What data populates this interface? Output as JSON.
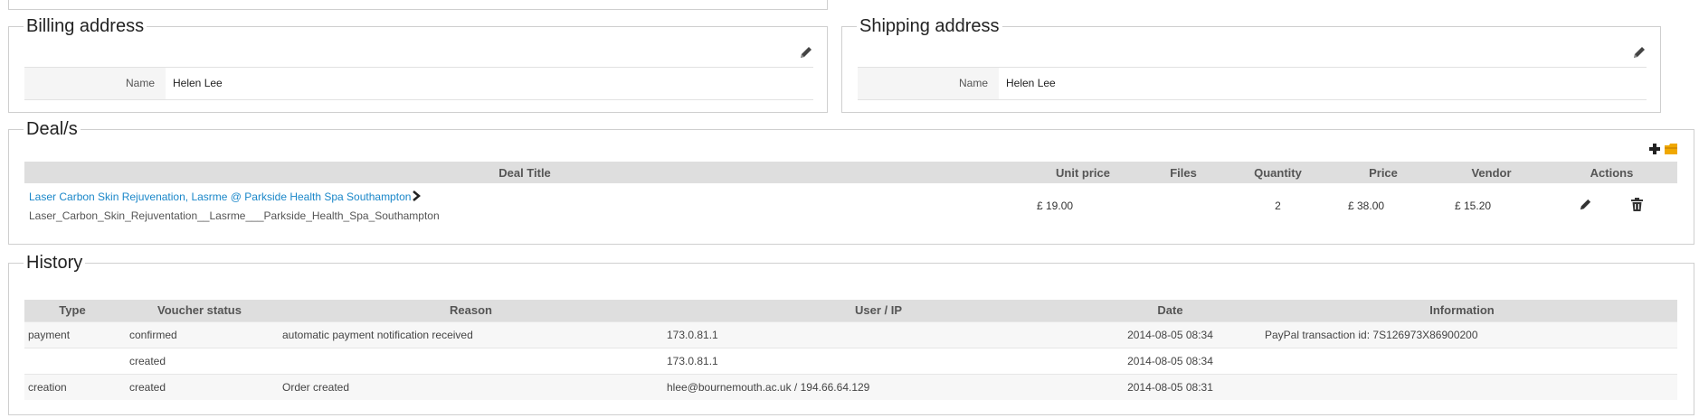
{
  "billing": {
    "title": "Billing address",
    "name_label": "Name",
    "name_value": "Helen Lee"
  },
  "shipping": {
    "title": "Shipping address",
    "name_label": "Name",
    "name_value": "Helen Lee"
  },
  "deals": {
    "title": "Deal/s",
    "columns": [
      "Deal Title",
      "Unit price",
      "Files",
      "Quantity",
      "Price",
      "Vendor",
      "Actions"
    ],
    "rows": [
      {
        "title": "Laser Carbon Skin Rejuvenation, Lasrme @ Parkside Health Spa Southampton",
        "subtitle": "Laser_Carbon_Skin_Rejuventation__Lasrme___Parkside_Health_Spa_Southampton",
        "unit_price": "£ 19.00",
        "files": "",
        "quantity": "2",
        "price": "£ 38.00",
        "vendor": "£ 15.20"
      }
    ]
  },
  "history": {
    "title": "History",
    "columns": [
      "Type",
      "Voucher status",
      "Reason",
      "User / IP",
      "Date",
      "Information"
    ],
    "rows": [
      {
        "type": "payment",
        "status": "confirmed",
        "reason": "automatic payment notification received",
        "user_ip": "173.0.81.1",
        "date": "2014-08-05 08:34",
        "info": "PayPal transaction id: 7S126973X86900200"
      },
      {
        "type": "",
        "status": "created",
        "reason": "",
        "user_ip": "173.0.81.1",
        "date": "2014-08-05 08:34",
        "info": ""
      },
      {
        "type": "creation",
        "status": "created",
        "reason": "Order created",
        "user_ip": "hlee@bournemouth.ac.uk / 194.66.64.129",
        "date": "2014-08-05 08:31",
        "info": ""
      }
    ]
  },
  "icons": {
    "edit": "pencil-icon",
    "delete": "trash-icon",
    "add": "plus-icon",
    "folder": "folder-icon",
    "chevron": "chevron-right-icon"
  },
  "colors": {
    "link": "#1a87c9",
    "header_bg": "#dedede",
    "border": "#cfcfcf",
    "folder": "#f0a800"
  }
}
